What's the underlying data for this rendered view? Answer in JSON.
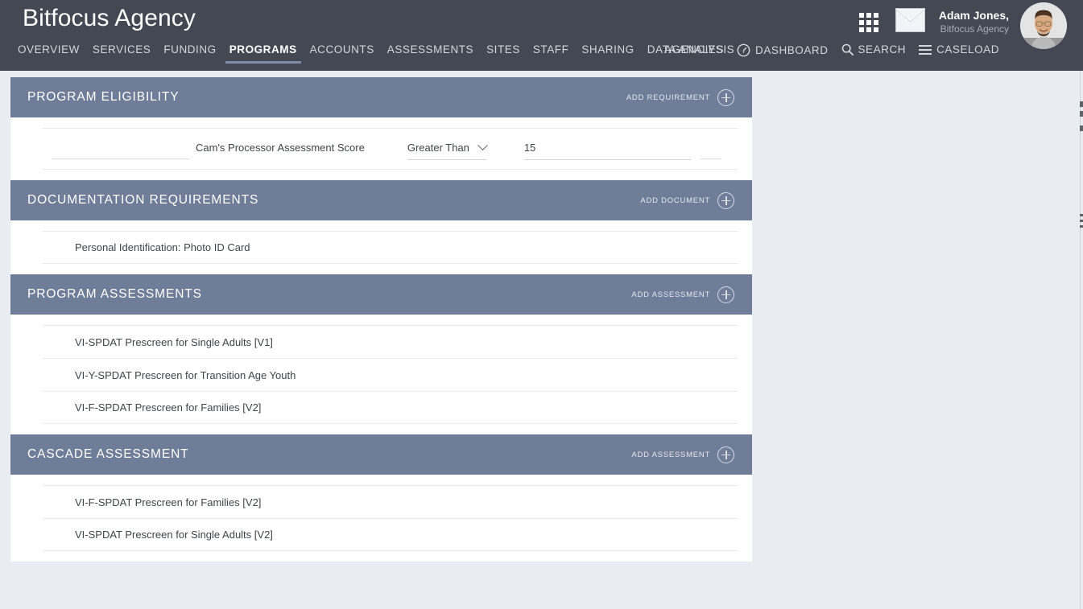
{
  "header": {
    "brand": "Bitfocus Agency",
    "nav": [
      {
        "label": "OVERVIEW",
        "active": false
      },
      {
        "label": "SERVICES",
        "active": false
      },
      {
        "label": "FUNDING",
        "active": false
      },
      {
        "label": "PROGRAMS",
        "active": true
      },
      {
        "label": "ACCOUNTS",
        "active": false
      },
      {
        "label": "ASSESSMENTS",
        "active": false
      },
      {
        "label": "SITES",
        "active": false
      },
      {
        "label": "STAFF",
        "active": false
      },
      {
        "label": "SHARING",
        "active": false
      },
      {
        "label": "DATA ANALYSIS",
        "active": false
      }
    ],
    "right_nav": [
      {
        "label": "AGENCIES",
        "icon": ""
      },
      {
        "label": "DASHBOARD",
        "icon": "speedometer-icon"
      },
      {
        "label": "SEARCH",
        "icon": "magnifier-icon"
      },
      {
        "label": "CASELOAD",
        "icon": "hamburger-icon"
      }
    ],
    "apps_icon": "grid-apps-icon",
    "mail_icon": "envelope-icon",
    "user": {
      "name": "Adam Jones,",
      "org": "Bitfocus Agency",
      "avatar": "user-avatar"
    }
  },
  "colors": {
    "topbar": "#434853",
    "panel_header": "#6f7d99",
    "page_bg": "#e9ecf1",
    "panel_bg": "#ffffff",
    "active_underline": "#7f8da8",
    "row_divider": "#e7e9ec"
  },
  "sections": [
    {
      "id": "program-eligibility",
      "title": "Program Eligibility",
      "action_label": "Add Requirement",
      "type": "eligibility",
      "rows": [
        {
          "blank_left": "",
          "label": "Cam's Processor Assessment Score",
          "operator": "Greater Than",
          "value": "15",
          "trailing": ""
        }
      ]
    },
    {
      "id": "documentation-requirements",
      "title": "Documentation Requirements",
      "action_label": "Add Document",
      "type": "list",
      "rows": [
        {
          "label": "Personal Identification: Photo ID Card"
        }
      ]
    },
    {
      "id": "program-assessments",
      "title": "Program Assessments",
      "action_label": "Add Assessment",
      "type": "list",
      "rows": [
        {
          "label": "VI-SPDAT Prescreen for Single Adults [V1]"
        },
        {
          "label": "VI-Y-SPDAT Prescreen for Transition Age Youth"
        },
        {
          "label": "VI-F-SPDAT Prescreen for Families [V2]"
        }
      ]
    },
    {
      "id": "cascade-assessment",
      "title": "Cascade Assessment",
      "action_label": "Add Assessment",
      "type": "list",
      "rows": [
        {
          "label": "VI-F-SPDAT Prescreen for Families [V2]"
        },
        {
          "label": "VI-SPDAT Prescreen for Single Adults [V2]"
        }
      ]
    }
  ]
}
